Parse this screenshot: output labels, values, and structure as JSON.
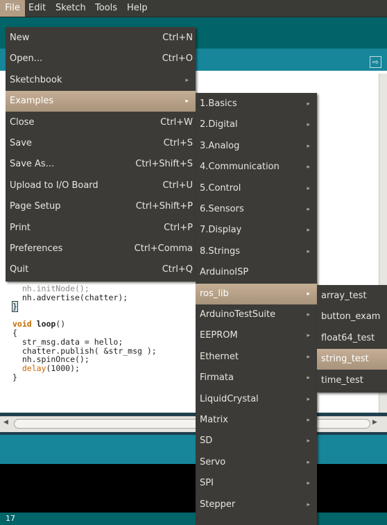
{
  "menubar": [
    "File",
    "Edit",
    "Sketch",
    "Tools",
    "Help"
  ],
  "file_menu": [
    {
      "label": "New",
      "shortcut": "Ctrl+N"
    },
    {
      "label": "Open...",
      "shortcut": "Ctrl+O"
    },
    {
      "label": "Sketchbook",
      "submenu": true
    },
    {
      "label": "Examples",
      "submenu": true,
      "highlighted": true
    },
    {
      "label": "Close",
      "shortcut": "Ctrl+W"
    },
    {
      "label": "Save",
      "shortcut": "Ctrl+S"
    },
    {
      "label": "Save As...",
      "shortcut": "Ctrl+Shift+S"
    },
    {
      "label": "Upload to I/O Board",
      "shortcut": "Ctrl+U"
    },
    {
      "label": "Page Setup",
      "shortcut": "Ctrl+Shift+P"
    },
    {
      "label": "Print",
      "shortcut": "Ctrl+P"
    },
    {
      "label": "Preferences",
      "shortcut": "Ctrl+Comma"
    },
    {
      "label": "Quit",
      "shortcut": "Ctrl+Q"
    }
  ],
  "examples_menu": [
    {
      "label": "1.Basics",
      "submenu": true
    },
    {
      "label": "2.Digital",
      "submenu": true
    },
    {
      "label": "3.Analog",
      "submenu": true
    },
    {
      "label": "4.Communication",
      "submenu": true
    },
    {
      "label": "5.Control",
      "submenu": true
    },
    {
      "label": "6.Sensors",
      "submenu": true
    },
    {
      "label": "7.Display",
      "submenu": true
    },
    {
      "label": "8.Strings",
      "submenu": true
    },
    {
      "label": "ArduinoISP",
      "submenu": false
    },
    {
      "label": "ros_lib",
      "submenu": true,
      "highlighted": true
    },
    {
      "label": "ArduinoTestSuite",
      "submenu": true
    },
    {
      "label": "EEPROM",
      "submenu": true
    },
    {
      "label": "Ethernet",
      "submenu": true
    },
    {
      "label": "Firmata",
      "submenu": true
    },
    {
      "label": "LiquidCrystal",
      "submenu": true
    },
    {
      "label": "Matrix",
      "submenu": true
    },
    {
      "label": "SD",
      "submenu": true
    },
    {
      "label": "Servo",
      "submenu": true
    },
    {
      "label": "SPI",
      "submenu": true
    },
    {
      "label": "Stepper",
      "submenu": true
    }
  ],
  "roslib_menu": [
    {
      "label": "array_test"
    },
    {
      "label": "button_exam"
    },
    {
      "label": "float64_test"
    },
    {
      "label": "string_test",
      "highlighted": true
    },
    {
      "label": "time_test"
    }
  ],
  "code": {
    "l1": "  nh.advertise(chatter);",
    "l2": "}",
    "l3_kw": "void",
    "l3_fn": "loop",
    "l3_rest": "()",
    "l4": "{",
    "l5": "  str_msg.data = hello;",
    "l6": "  chatter.publish( &str_msg );",
    "l7": "  nh.spinOnce();",
    "l8_fn": "  delay",
    "l8_rest": "(1000);",
    "l9": "}"
  },
  "status": {
    "line_number": "17"
  },
  "icons": {
    "serial_monitor": "serial-monitor-icon",
    "submenu_arrow": "▸"
  }
}
